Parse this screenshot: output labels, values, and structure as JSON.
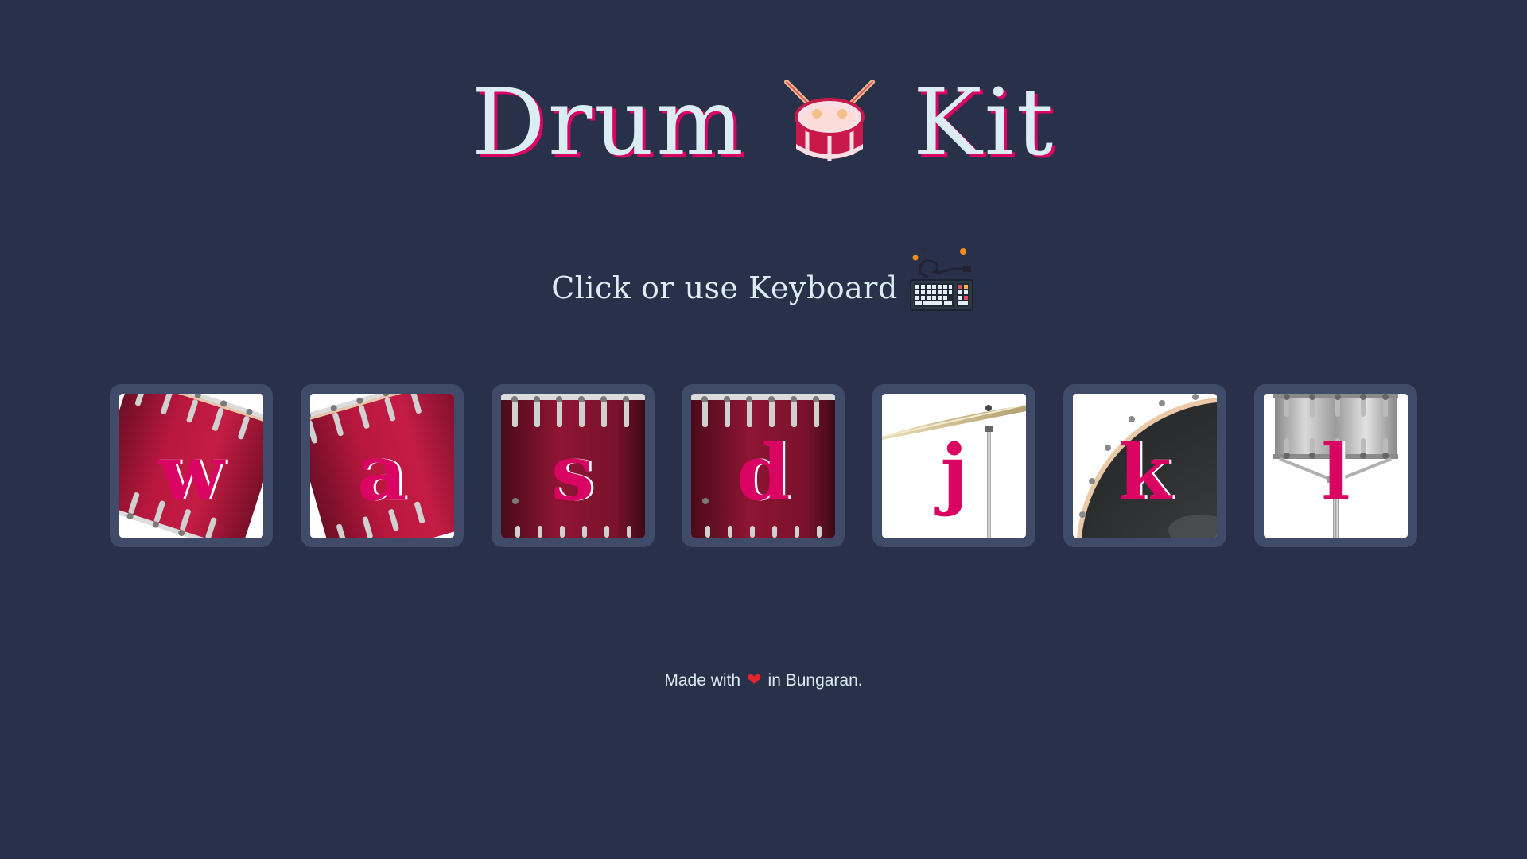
{
  "header": {
    "title_left": "Drum",
    "title_right": "Kit",
    "title_icon": "drum-icon"
  },
  "subtitle": {
    "text": "Click or use Keyboard",
    "icon": "keyboard-icon"
  },
  "pads": [
    {
      "key": "w",
      "image": "tom-1"
    },
    {
      "key": "a",
      "image": "tom-2"
    },
    {
      "key": "s",
      "image": "tom-3"
    },
    {
      "key": "d",
      "image": "tom-4"
    },
    {
      "key": "j",
      "image": "crash-cymbal"
    },
    {
      "key": "k",
      "image": "kick-bass"
    },
    {
      "key": "l",
      "image": "snare"
    }
  ],
  "footer": {
    "prefix": "Made with",
    "icon": "heart-icon",
    "suffix": "in Bungaran."
  },
  "colors": {
    "background": "#283149",
    "pad_frame": "#404b69",
    "accent": "#da0463",
    "text": "#dbedf3",
    "heart": "#e5252a"
  }
}
